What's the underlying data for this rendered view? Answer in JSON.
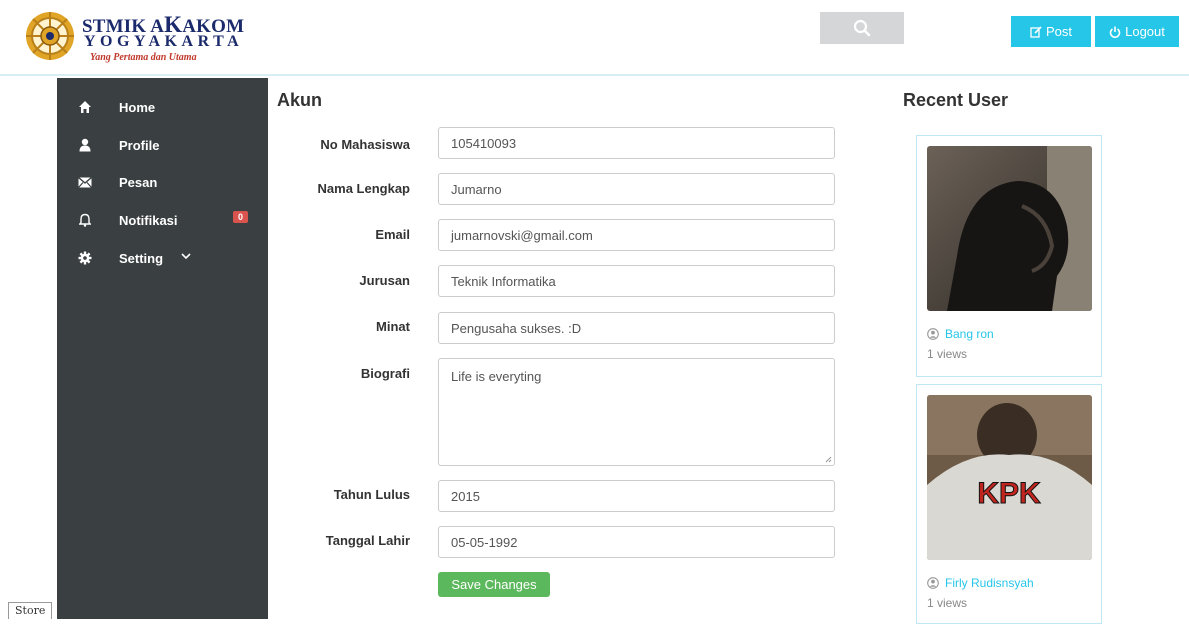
{
  "header": {
    "logo_line1_prefix": "STMIK A",
    "logo_line1_big": "K",
    "logo_line1_suffix": "AKOM",
    "logo_line2": "YOGYAKARTA",
    "logo_tagline": "Yang Pertama dan Utama",
    "post_label": "Post",
    "logout_label": "Logout",
    "accent_color": "#26c6e8"
  },
  "sidebar": {
    "items": [
      {
        "label": "Home",
        "icon": "home-icon"
      },
      {
        "label": "Profile",
        "icon": "user-icon"
      },
      {
        "label": "Pesan",
        "icon": "envelope-icon"
      },
      {
        "label": "Notifikasi",
        "icon": "bell-icon",
        "badge": "0"
      },
      {
        "label": "Setting",
        "icon": "gear-icon"
      }
    ]
  },
  "main": {
    "title": "Akun",
    "fields": [
      {
        "label": "No Mahasiswa",
        "value": "105410093"
      },
      {
        "label": "Nama Lengkap",
        "value": "Jumarno"
      },
      {
        "label": "Email",
        "value": "jumarnovski@gmail.com"
      },
      {
        "label": "Jurusan",
        "value": "Teknik Informatika"
      },
      {
        "label": "Minat",
        "value": "Pengusaha sukses. :D"
      },
      {
        "label": "Biografi",
        "value": "Life is everyting"
      },
      {
        "label": "Tahun Lulus",
        "value": "2015"
      },
      {
        "label": "Tanggal Lahir",
        "value": "05-05-1992"
      }
    ],
    "save_label": "Save Changes"
  },
  "recent": {
    "title": "Recent User",
    "users": [
      {
        "name": "Bang ron",
        "views": "1 views"
      },
      {
        "name": "Firly Rudisnsyah",
        "views": "1 views"
      }
    ]
  },
  "footer": {
    "store_tab": "Store"
  }
}
